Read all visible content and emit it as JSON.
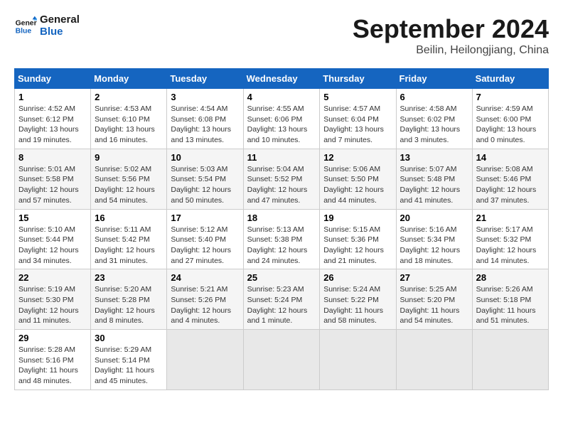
{
  "logo": {
    "line1": "General",
    "line2": "Blue"
  },
  "title": "September 2024",
  "subtitle": "Beilin, Heilongjiang, China",
  "days_of_week": [
    "Sunday",
    "Monday",
    "Tuesday",
    "Wednesday",
    "Thursday",
    "Friday",
    "Saturday"
  ],
  "weeks": [
    [
      {
        "day": "1",
        "sunrise": "4:52 AM",
        "sunset": "6:12 PM",
        "daylight": "13 hours and 19 minutes."
      },
      {
        "day": "2",
        "sunrise": "4:53 AM",
        "sunset": "6:10 PM",
        "daylight": "13 hours and 16 minutes."
      },
      {
        "day": "3",
        "sunrise": "4:54 AM",
        "sunset": "6:08 PM",
        "daylight": "13 hours and 13 minutes."
      },
      {
        "day": "4",
        "sunrise": "4:55 AM",
        "sunset": "6:06 PM",
        "daylight": "13 hours and 10 minutes."
      },
      {
        "day": "5",
        "sunrise": "4:57 AM",
        "sunset": "6:04 PM",
        "daylight": "13 hours and 7 minutes."
      },
      {
        "day": "6",
        "sunrise": "4:58 AM",
        "sunset": "6:02 PM",
        "daylight": "13 hours and 3 minutes."
      },
      {
        "day": "7",
        "sunrise": "4:59 AM",
        "sunset": "6:00 PM",
        "daylight": "13 hours and 0 minutes."
      }
    ],
    [
      {
        "day": "8",
        "sunrise": "5:01 AM",
        "sunset": "5:58 PM",
        "daylight": "12 hours and 57 minutes."
      },
      {
        "day": "9",
        "sunrise": "5:02 AM",
        "sunset": "5:56 PM",
        "daylight": "12 hours and 54 minutes."
      },
      {
        "day": "10",
        "sunrise": "5:03 AM",
        "sunset": "5:54 PM",
        "daylight": "12 hours and 50 minutes."
      },
      {
        "day": "11",
        "sunrise": "5:04 AM",
        "sunset": "5:52 PM",
        "daylight": "12 hours and 47 minutes."
      },
      {
        "day": "12",
        "sunrise": "5:06 AM",
        "sunset": "5:50 PM",
        "daylight": "12 hours and 44 minutes."
      },
      {
        "day": "13",
        "sunrise": "5:07 AM",
        "sunset": "5:48 PM",
        "daylight": "12 hours and 41 minutes."
      },
      {
        "day": "14",
        "sunrise": "5:08 AM",
        "sunset": "5:46 PM",
        "daylight": "12 hours and 37 minutes."
      }
    ],
    [
      {
        "day": "15",
        "sunrise": "5:10 AM",
        "sunset": "5:44 PM",
        "daylight": "12 hours and 34 minutes."
      },
      {
        "day": "16",
        "sunrise": "5:11 AM",
        "sunset": "5:42 PM",
        "daylight": "12 hours and 31 minutes."
      },
      {
        "day": "17",
        "sunrise": "5:12 AM",
        "sunset": "5:40 PM",
        "daylight": "12 hours and 27 minutes."
      },
      {
        "day": "18",
        "sunrise": "5:13 AM",
        "sunset": "5:38 PM",
        "daylight": "12 hours and 24 minutes."
      },
      {
        "day": "19",
        "sunrise": "5:15 AM",
        "sunset": "5:36 PM",
        "daylight": "12 hours and 21 minutes."
      },
      {
        "day": "20",
        "sunrise": "5:16 AM",
        "sunset": "5:34 PM",
        "daylight": "12 hours and 18 minutes."
      },
      {
        "day": "21",
        "sunrise": "5:17 AM",
        "sunset": "5:32 PM",
        "daylight": "12 hours and 14 minutes."
      }
    ],
    [
      {
        "day": "22",
        "sunrise": "5:19 AM",
        "sunset": "5:30 PM",
        "daylight": "12 hours and 11 minutes."
      },
      {
        "day": "23",
        "sunrise": "5:20 AM",
        "sunset": "5:28 PM",
        "daylight": "12 hours and 8 minutes."
      },
      {
        "day": "24",
        "sunrise": "5:21 AM",
        "sunset": "5:26 PM",
        "daylight": "12 hours and 4 minutes."
      },
      {
        "day": "25",
        "sunrise": "5:23 AM",
        "sunset": "5:24 PM",
        "daylight": "12 hours and 1 minute."
      },
      {
        "day": "26",
        "sunrise": "5:24 AM",
        "sunset": "5:22 PM",
        "daylight": "11 hours and 58 minutes."
      },
      {
        "day": "27",
        "sunrise": "5:25 AM",
        "sunset": "5:20 PM",
        "daylight": "11 hours and 54 minutes."
      },
      {
        "day": "28",
        "sunrise": "5:26 AM",
        "sunset": "5:18 PM",
        "daylight": "11 hours and 51 minutes."
      }
    ],
    [
      {
        "day": "29",
        "sunrise": "5:28 AM",
        "sunset": "5:16 PM",
        "daylight": "11 hours and 48 minutes."
      },
      {
        "day": "30",
        "sunrise": "5:29 AM",
        "sunset": "5:14 PM",
        "daylight": "11 hours and 45 minutes."
      },
      null,
      null,
      null,
      null,
      null
    ]
  ]
}
